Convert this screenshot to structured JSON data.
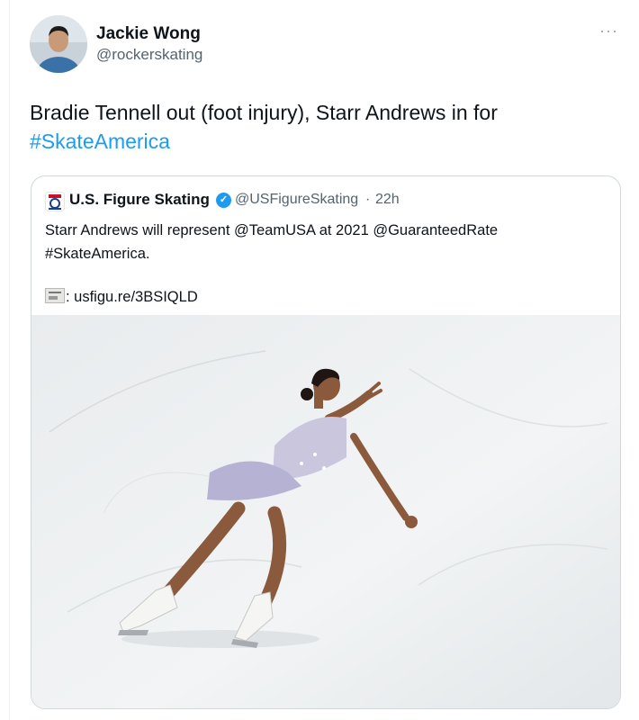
{
  "author": {
    "name": "Jackie Wong",
    "handle": "@rockerskating"
  },
  "tweet": {
    "text": "Bradie Tennell out (foot injury), Starr Andrews in for",
    "hashtag": "#SkateAmerica"
  },
  "more_menu": "···",
  "quoted_tweet": {
    "author_name": "U.S. Figure Skating",
    "handle": "@USFigureSkating",
    "separator": "·",
    "time": "22h",
    "line1": "Starr Andrews will represent @TeamUSA at 2021 @GuaranteedRate",
    "line2": "#SkateAmerica.",
    "link": ": usfigu.re/3BSIQLD",
    "verified_icon": "verified-badge-icon",
    "link_icon": "newspaper-icon"
  },
  "colors": {
    "link": "#1d9bf0",
    "secondary_text": "#536471",
    "border": "#cfd9de"
  }
}
